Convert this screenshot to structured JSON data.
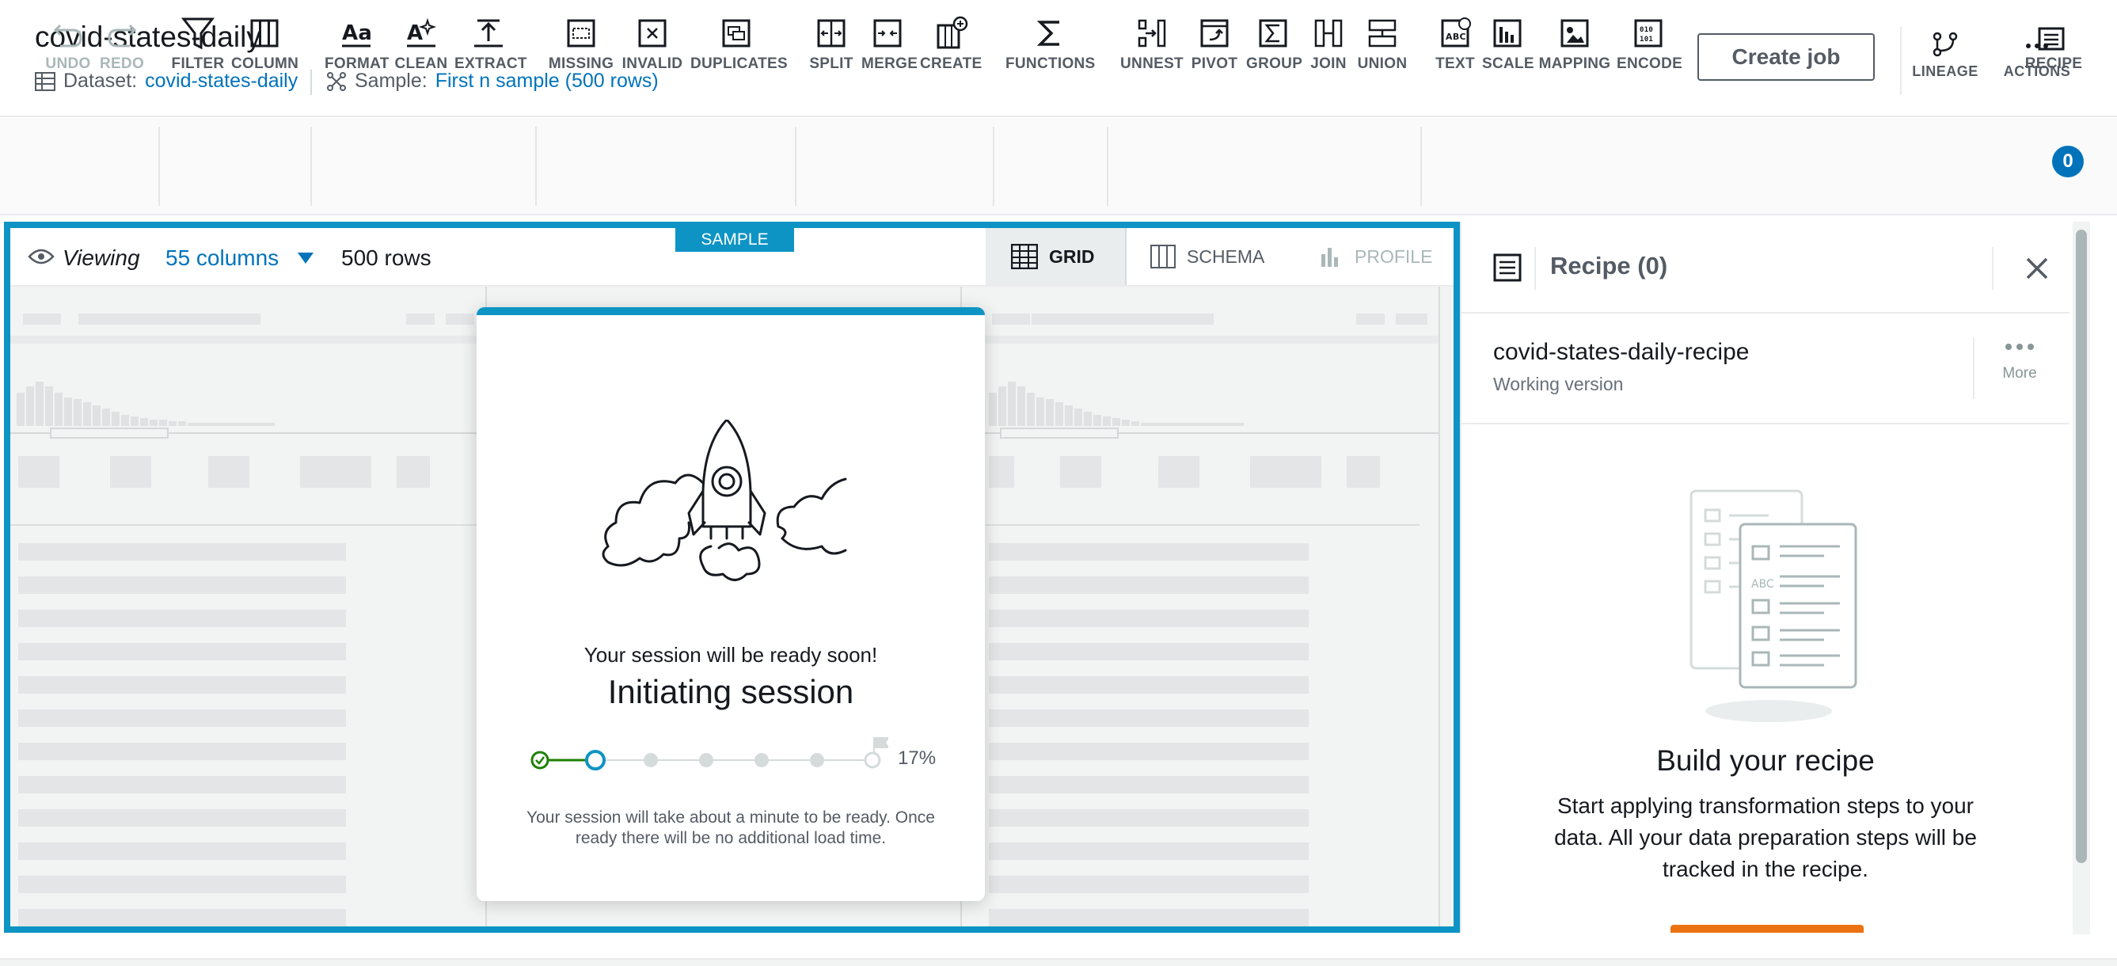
{
  "header": {
    "title": "covid-states-daily",
    "dataset_label": "Dataset:",
    "dataset_value": "covid-states-daily",
    "sample_label": "Sample:",
    "sample_value": "First n sample (500 rows)",
    "create_job": "Create job",
    "lineage": "LINEAGE",
    "actions": "ACTIONS"
  },
  "toolbar": {
    "undo": "UNDO",
    "redo": "REDO",
    "filter": "FILTER",
    "column": "COLUMN",
    "format": "FORMAT",
    "clean": "CLEAN",
    "extract": "EXTRACT",
    "missing": "MISSING",
    "invalid": "INVALID",
    "duplicates": "DUPLICATES",
    "split": "SPLIT",
    "merge": "MERGE",
    "create": "CREATE",
    "functions": "FUNCTIONS",
    "unnest": "UNNEST",
    "pivot": "PIVOT",
    "group": "GROUP",
    "join": "JOIN",
    "union": "UNION",
    "text": "TEXT",
    "scale": "SCALE",
    "mapping": "MAPPING",
    "encode": "ENCODE",
    "recipe": "RECIPE",
    "recipe_count": "0"
  },
  "viewbar": {
    "viewing": "Viewing",
    "columns": "55 columns",
    "rows": "500 rows",
    "sample_tag": "SAMPLE",
    "tab_grid": "GRID",
    "tab_schema": "SCHEMA",
    "tab_profile": "PROFILE"
  },
  "modal": {
    "subtitle": "Your session will be ready soon!",
    "title": "Initiating session",
    "progress_label": "17%",
    "progress_value": 0.17,
    "note_line1": "Your session will take about a minute to be ready. Once",
    "note_line2": "ready there will be no additional load time."
  },
  "sidebar": {
    "title": "Recipe (0)",
    "recipe_name": "covid-states-daily-recipe",
    "recipe_version": "Working version",
    "more": "More",
    "empty_title": "Build your recipe",
    "empty_line1": "Start applying transformation steps to your",
    "empty_line2": "data. All your data preparation steps will be",
    "empty_line3": "tracked in the recipe."
  },
  "colors": {
    "accent": "#0d94c4",
    "link": "#0073bb",
    "primary_button": "#ec7211",
    "progress_done": "#1d8102"
  }
}
